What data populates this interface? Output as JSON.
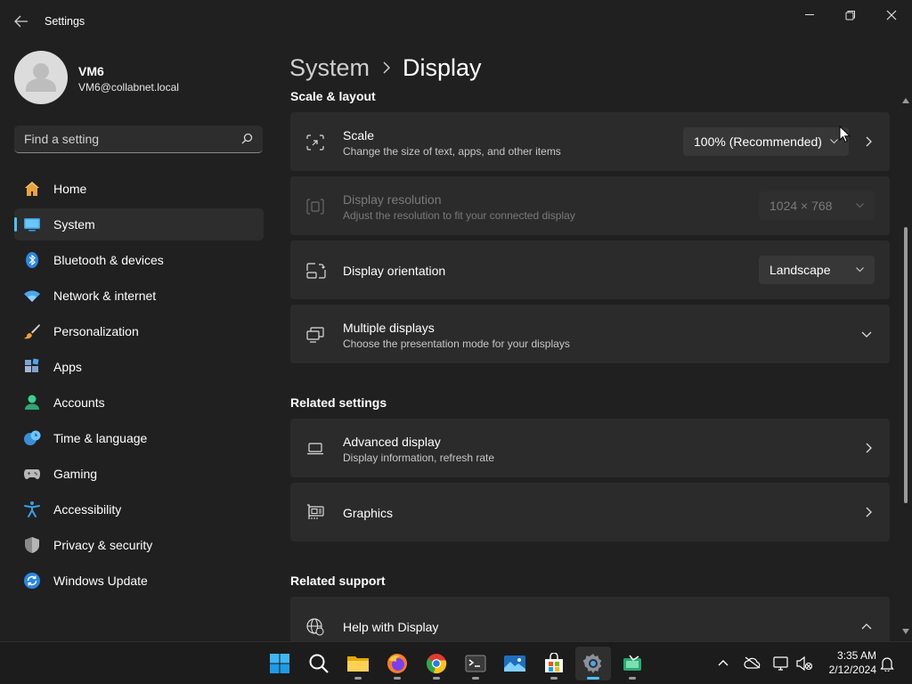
{
  "window": {
    "app_title": "Settings",
    "controls": {
      "minimize": "minimize-icon",
      "maximize": "restore-icon",
      "close": "close-icon"
    }
  },
  "profile": {
    "name": "VM6",
    "email": "VM6@collabnet.local"
  },
  "search": {
    "placeholder": "Find a setting"
  },
  "sidebar": {
    "items": [
      {
        "label": "Home",
        "icon": "home-icon",
        "active": false
      },
      {
        "label": "System",
        "icon": "system-icon",
        "active": true
      },
      {
        "label": "Bluetooth & devices",
        "icon": "bluetooth-icon",
        "active": false
      },
      {
        "label": "Network & internet",
        "icon": "wifi-icon",
        "active": false
      },
      {
        "label": "Personalization",
        "icon": "brush-icon",
        "active": false
      },
      {
        "label": "Apps",
        "icon": "apps-icon",
        "active": false
      },
      {
        "label": "Accounts",
        "icon": "accounts-icon",
        "active": false
      },
      {
        "label": "Time & language",
        "icon": "time-language-icon",
        "active": false
      },
      {
        "label": "Gaming",
        "icon": "gaming-icon",
        "active": false
      },
      {
        "label": "Accessibility",
        "icon": "accessibility-icon",
        "active": false
      },
      {
        "label": "Privacy & security",
        "icon": "shield-icon",
        "active": false
      },
      {
        "label": "Windows Update",
        "icon": "update-icon",
        "active": false
      }
    ]
  },
  "breadcrumb": {
    "parent": "System",
    "current": "Display"
  },
  "sections": {
    "scale_layout": "Scale & layout",
    "related_settings": "Related settings",
    "related_support": "Related support"
  },
  "cards": {
    "scale": {
      "title": "Scale",
      "subtitle": "Change the size of text, apps, and other items",
      "value": "100% (Recommended)"
    },
    "resolution": {
      "title": "Display resolution",
      "subtitle": "Adjust the resolution to fit your connected display",
      "value": "1024 × 768",
      "disabled": true
    },
    "orientation": {
      "title": "Display orientation",
      "value": "Landscape"
    },
    "multiple": {
      "title": "Multiple displays",
      "subtitle": "Choose the presentation mode for your displays"
    },
    "advanced": {
      "title": "Advanced display",
      "subtitle": "Display information, refresh rate"
    },
    "graphics": {
      "title": "Graphics"
    },
    "help": {
      "title": "Help with Display"
    }
  },
  "taskbar": {
    "apps": [
      "start-icon",
      "search-icon",
      "file-explorer-icon",
      "firefox-icon",
      "chrome-icon",
      "terminal-icon",
      "photos-icon",
      "store-icon",
      "settings-icon",
      "app-icon"
    ],
    "active_app": "settings-icon",
    "tray": [
      "chevron-up-icon",
      "onedrive-icon",
      "network-icon",
      "speaker-muted-icon",
      "notification-bell-icon"
    ],
    "time": "3:35 AM",
    "date": "2/12/2024"
  },
  "colors": {
    "accent": "#4cc2ff",
    "background": "#202020",
    "card": "#2b2b2b"
  }
}
